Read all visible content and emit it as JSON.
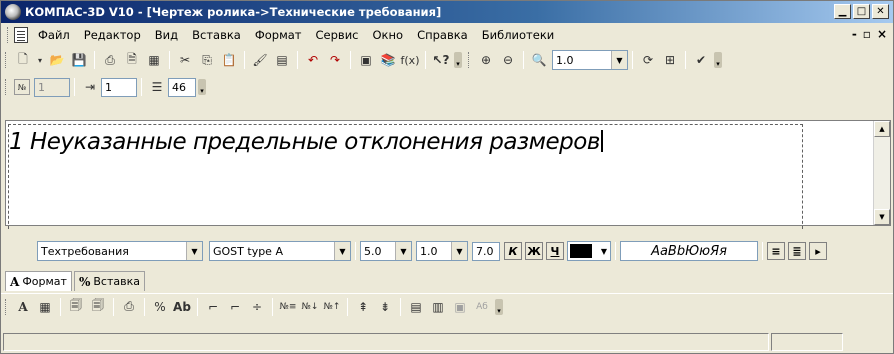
{
  "window": {
    "title": "КОМПАС-3D V10 - [Чертеж ролика->Технические требования]",
    "buttons": [
      "_",
      "□",
      "X"
    ]
  },
  "menu": {
    "items": [
      {
        "label": "Файл"
      },
      {
        "label": "Редактор"
      },
      {
        "label": "Вид"
      },
      {
        "label": "Вставка"
      },
      {
        "label": "Формат"
      },
      {
        "label": "Сервис"
      },
      {
        "label": "Окно"
      },
      {
        "label": "Справка"
      },
      {
        "label": "Библиотеки"
      }
    ],
    "mdi_buttons": [
      "-",
      "♂",
      "×"
    ]
  },
  "toolbar_standard": {
    "zoom_value": "1.0"
  },
  "toolbar_numbering": {
    "number_field": "1",
    "start_field": "1",
    "lines_field": "46"
  },
  "editor": {
    "text": "1 Неуказанные предельные отклонения размеров"
  },
  "format": {
    "style": "Техтребования",
    "font": "GOST type A",
    "size": "5.0",
    "stretch": "1.0",
    "spacing": "7.0",
    "bold_label": "К",
    "italic_label": "Ж",
    "underline_label": "Ч",
    "color": "#000000",
    "sample": "АаВbЮюЯя"
  },
  "tabs": [
    {
      "label": "Формат",
      "glyph": "A",
      "active": true
    },
    {
      "label": "Вставка",
      "glyph": "%",
      "active": false
    }
  ],
  "colors": {
    "title_start": "#0a246a",
    "title_end": "#a6caf0",
    "chrome": "#ece9d8"
  }
}
